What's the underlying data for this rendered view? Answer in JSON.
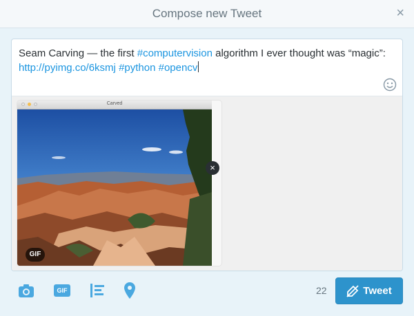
{
  "dialog": {
    "title": "Compose new Tweet",
    "close_label": "×"
  },
  "composer": {
    "text_plain_1": "Seam Carving — the first ",
    "hashtag_1": "#computervision",
    "text_plain_2": " algorithm I ever thought was “magic”:",
    "link": "http://pyimg.co/6ksmj",
    "hashtag_2": "#python",
    "hashtag_3": "#opencv",
    "emoji_icon": "smiley-icon"
  },
  "media": {
    "window_title": "Carved",
    "badge": "GIF",
    "remove_label": "×"
  },
  "toolbar": {
    "icons": [
      "camera-icon",
      "gif-icon",
      "poll-icon",
      "location-icon"
    ],
    "gif_label": "GIF",
    "char_count": "22",
    "tweet_label": "Tweet"
  },
  "colors": {
    "accent": "#2d93cc",
    "link": "#1b95e0",
    "toolbar_icon": "#4aa8e0"
  }
}
